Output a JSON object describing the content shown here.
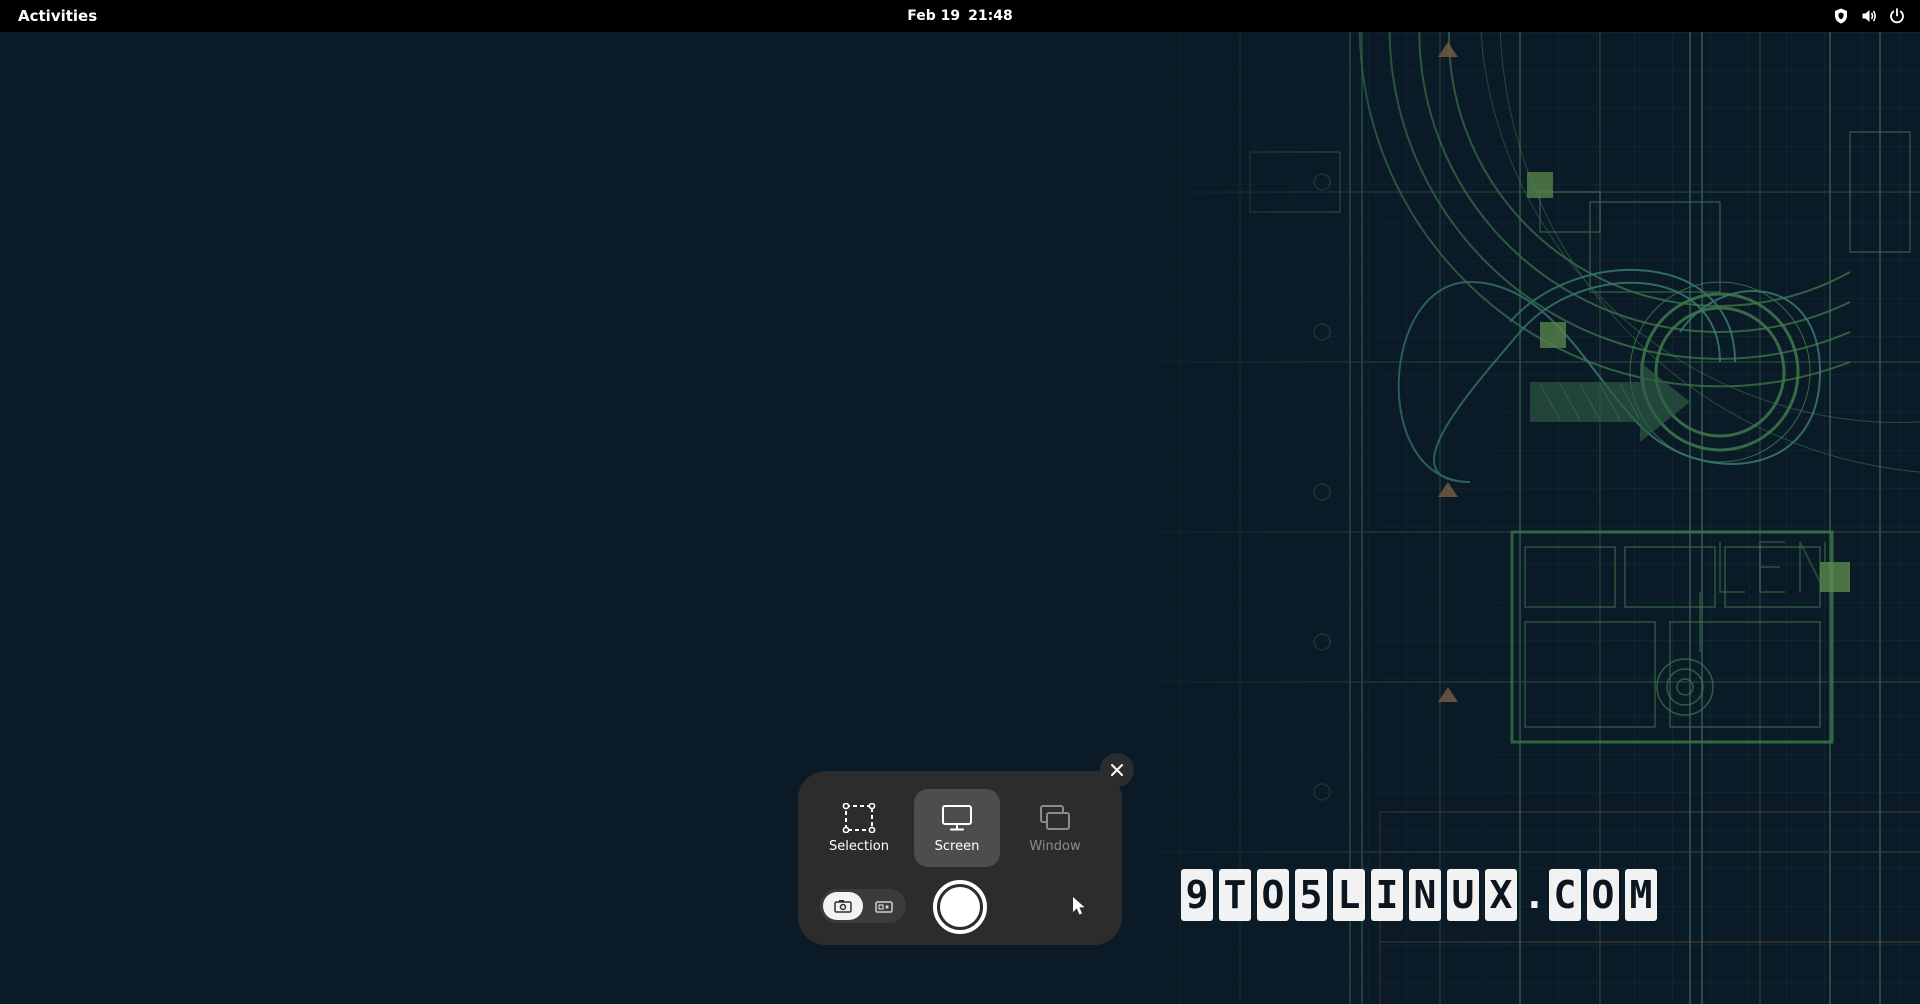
{
  "topbar": {
    "activities_label": "Activities",
    "date": "Feb 19",
    "time": "21:48",
    "tray_icons": [
      "shield-icon",
      "volume-icon",
      "power-icon"
    ]
  },
  "screenshot_ui": {
    "modes": [
      {
        "label": "Selection",
        "icon": "selection-icon",
        "state": "normal"
      },
      {
        "label": "Screen",
        "icon": "monitor-icon",
        "state": "selected"
      },
      {
        "label": "Window",
        "icon": "window-icon",
        "state": "disabled"
      }
    ],
    "capture_type": "screenshot",
    "show_pointer_icon": "pointer-icon",
    "close_icon": "close-icon"
  },
  "watermark": {
    "characters": [
      "9",
      "T",
      "O",
      "5",
      "L",
      "I",
      "N",
      "U",
      "X",
      ".",
      "C",
      "O",
      "M"
    ]
  },
  "colors": {
    "background": "#0a1a26",
    "panel": "#2c2c2c",
    "panel_selected": "#4d4d4d",
    "blueprint_green": "#3f7a4c",
    "blueprint_teal": "#2f6a6a"
  }
}
